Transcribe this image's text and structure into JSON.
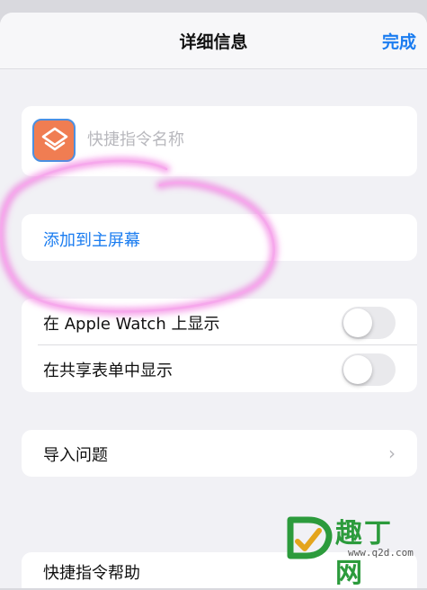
{
  "navbar": {
    "title": "详细信息",
    "done_label": "完成"
  },
  "shortcut": {
    "icon": "layers-icon",
    "icon_color": "#f07d52",
    "name_value": "",
    "name_placeholder": "快捷指令名称"
  },
  "home_screen": {
    "label": "添加到主屏幕"
  },
  "toggles": [
    {
      "label": "在 Apple Watch 上显示",
      "on": false
    },
    {
      "label": "在共享表单中显示",
      "on": false
    }
  ],
  "import_questions": {
    "label": "导入问题",
    "icon": "chevron-right-icon"
  },
  "help": {
    "label": "快捷指令帮助"
  },
  "annotation": {
    "color": "#ee5ad8"
  },
  "watermark": {
    "text": "趣丁网",
    "url": "www.q2d.com"
  },
  "colors": {
    "accent": "#1a7cf0",
    "background": "#f1f1f5"
  }
}
